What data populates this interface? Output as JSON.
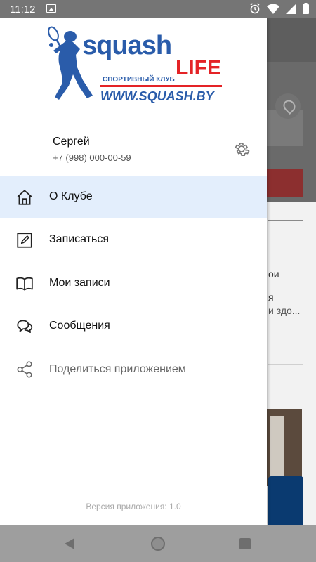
{
  "status_bar": {
    "time": "11:12",
    "left_icon": "image-icon",
    "right_icons": [
      "alarm-icon",
      "wifi-icon",
      "cellular-icon",
      "battery-icon"
    ]
  },
  "logo": {
    "word1": "squash",
    "word2": "LIFE",
    "tagline": "СПОРТИВНЫЙ КЛУБ",
    "site": "WWW.SQUASH.BY",
    "colors": {
      "blue": "#2a5caa",
      "red": "#e42326"
    }
  },
  "profile": {
    "name": "Сергей",
    "phone": "+7 (998) 000-00-59"
  },
  "menu": {
    "items": [
      {
        "label": "О Клубе",
        "icon": "home-icon",
        "active": true
      },
      {
        "label": "Записаться",
        "icon": "edit-icon",
        "active": false
      },
      {
        "label": "Мои записи",
        "icon": "book-icon",
        "active": false
      },
      {
        "label": "Сообщения",
        "icon": "chat-icon",
        "active": false
      }
    ],
    "share_label": "Поделиться приложением"
  },
  "version": "Версия приложения: 1.0",
  "background_fragments": {
    "line1": "ои",
    "line2": "я",
    "line3": "и здо..."
  },
  "colors": {
    "active_item_bg": "#e3eefc",
    "status_bar": "#757575",
    "nav_bar": "#9e9e9e"
  }
}
